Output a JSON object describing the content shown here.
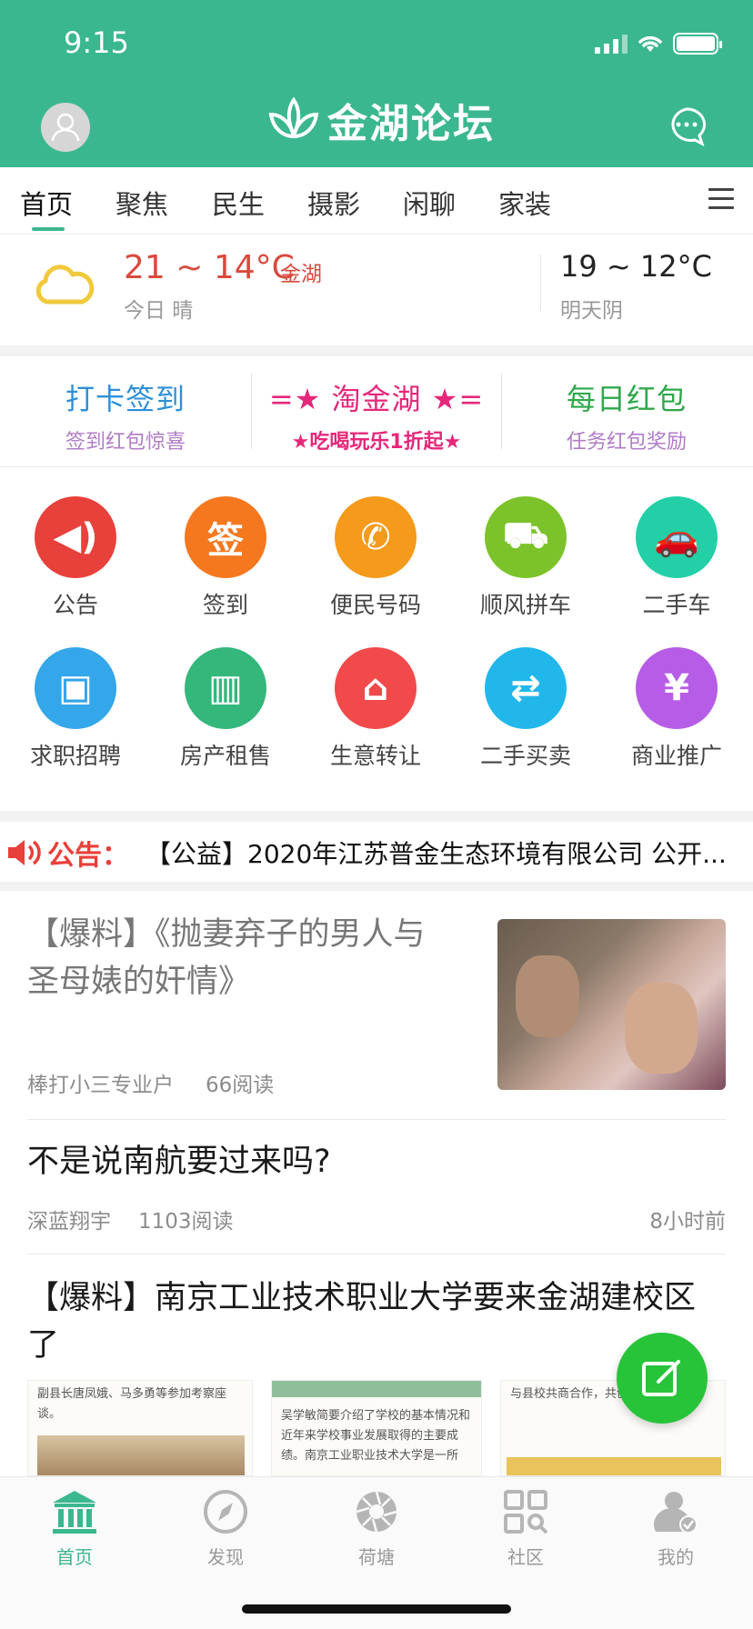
{
  "status_bar": {
    "time": "9:15"
  },
  "header": {
    "logo_text": "金湖论坛"
  },
  "tabs": [
    {
      "label": "首页",
      "active": true
    },
    {
      "label": "聚焦"
    },
    {
      "label": "民生"
    },
    {
      "label": "摄影"
    },
    {
      "label": "闲聊"
    },
    {
      "label": "家装"
    }
  ],
  "weather": {
    "today_temp": "21 ~ 14°C",
    "location": "金湖",
    "today_desc": "今日 晴",
    "tomorrow_temp": "19 ~ 12°C",
    "tomorrow_desc": "明天阴"
  },
  "quick_links": [
    {
      "title": "打卡签到",
      "subtitle": "签到红包惊喜",
      "title_color": "#2f8fd8",
      "sub_color": "#b07cc6"
    },
    {
      "title": "=★ 淘金湖 ★=",
      "subtitle": "★吃喝玩乐1折起★",
      "title_color": "#e6287a",
      "sub_color": "#e6287a"
    },
    {
      "title": "每日红包",
      "subtitle": "任务红包奖励",
      "title_color": "#2ea84a",
      "sub_color": "#b07cc6"
    }
  ],
  "services": [
    {
      "label": "公告",
      "icon": "speaker-icon",
      "color": "#e8403a",
      "glyph": "◀)"
    },
    {
      "label": "签到",
      "icon": "sign-in-icon",
      "color": "#f5781f",
      "glyph": "签"
    },
    {
      "label": "便民号码",
      "icon": "phone-icon",
      "color": "#f59a1a",
      "glyph": "✆"
    },
    {
      "label": "顺风拼车",
      "icon": "carpool-icon",
      "color": "#7cc22a",
      "glyph": "⛟"
    },
    {
      "label": "二手车",
      "icon": "car-icon",
      "color": "#22cfa6",
      "glyph": "🚗"
    },
    {
      "label": "求职招聘",
      "icon": "briefcase-icon",
      "color": "#34a6ea",
      "glyph": "▣"
    },
    {
      "label": "房产租售",
      "icon": "building-icon",
      "color": "#34b77b",
      "glyph": "▥"
    },
    {
      "label": "生意转让",
      "icon": "shop-icon",
      "color": "#f2494b",
      "glyph": "⌂"
    },
    {
      "label": "二手买卖",
      "icon": "exchange-icon",
      "color": "#21b7ea",
      "glyph": "⇄"
    },
    {
      "label": "商业推广",
      "icon": "yuan-icon",
      "color": "#b65ce6",
      "glyph": "¥"
    }
  ],
  "notice": {
    "label": "公告：",
    "text": "【公益】2020年江苏普金生态环境有限公司 公开..."
  },
  "articles": [
    {
      "title": "【爆料】《抛妻弃子的男人与圣母婊的奸情》",
      "author": "棒打小三专业户",
      "reads": "66阅读"
    },
    {
      "title": "不是说南航要过来吗?",
      "author": "深蓝翔宇",
      "reads": "1103阅读",
      "time": "8小时前"
    },
    {
      "title": "【爆料】南京工业技术职业大学要来金湖建校区了",
      "thumb1_text": "副县长唐凤娥、马多勇等参加考察座谈。",
      "thumb2_text": "吴学敏简要介绍了学校的基本情况和近年来学校事业发展取得的主要成绩。南京工业职业技术大学是一所",
      "thumb3_text": "与县校共商合作，共创未来。"
    }
  ],
  "bottom_nav": [
    {
      "label": "首页",
      "icon": "home-icon",
      "active": true
    },
    {
      "label": "发现",
      "icon": "compass-icon"
    },
    {
      "label": "荷塘",
      "icon": "aperture-icon"
    },
    {
      "label": "社区",
      "icon": "grid-search-icon"
    },
    {
      "label": "我的",
      "icon": "user-icon"
    }
  ]
}
